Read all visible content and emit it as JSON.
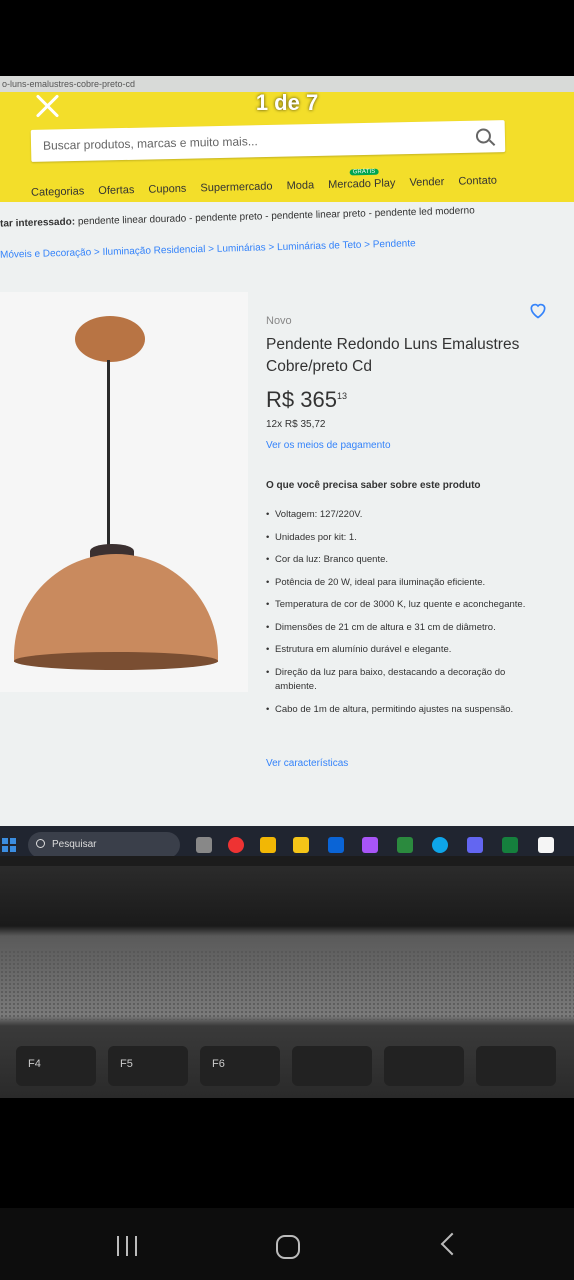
{
  "viewer": {
    "counter": "1 de 7"
  },
  "browser": {
    "url_fragment": "o-luns-emalustres-cobre-preto-cd"
  },
  "header": {
    "search_placeholder": "Buscar produtos, marcas e muito mais...",
    "nav": [
      "Categorias",
      "Ofertas",
      "Cupons",
      "Supermercado",
      "Moda",
      "Mercado Play",
      "Vender",
      "Contato"
    ],
    "badge": "GRÁTIS"
  },
  "interest": {
    "label": "tar interessado:",
    "items": "pendente linear dourado - pendente preto - pendente linear preto - pendente led moderno"
  },
  "breadcrumb": [
    "Móveis e Decoração",
    "Iluminação Residencial",
    "Luminárias",
    "Luminárias de Teto",
    "Pendente"
  ],
  "product": {
    "condition": "Novo",
    "title": "Pendente Redondo Luns Emalustres Cobre/preto Cd",
    "price_main": "R$ 365",
    "price_cents": "13",
    "installments": "12x R$ 35,72",
    "payment_link": "Ver os meios de pagamento",
    "info_heading": "O que você precisa saber sobre este produto",
    "bullets": [
      "Voltagem: 127/220V.",
      "Unidades por kit: 1.",
      "Cor da luz: Branco quente.",
      "Potência de 20 W, ideal para iluminação eficiente.",
      "Temperatura de cor de 3000 K, luz quente e aconchegante.",
      "Dimensões de 21 cm de altura e 31 cm de diâmetro.",
      "Estrutura em alumínio durável e elegante.",
      "Direção da luz para baixo, destacando a decoração do ambiente.",
      "Cabo de 1m de altura, permitindo ajustes na suspensão."
    ],
    "features_link": "Ver características"
  },
  "taskbar": {
    "search_label": "Pesquisar"
  },
  "keys": [
    "F4",
    "F5",
    "F6"
  ]
}
